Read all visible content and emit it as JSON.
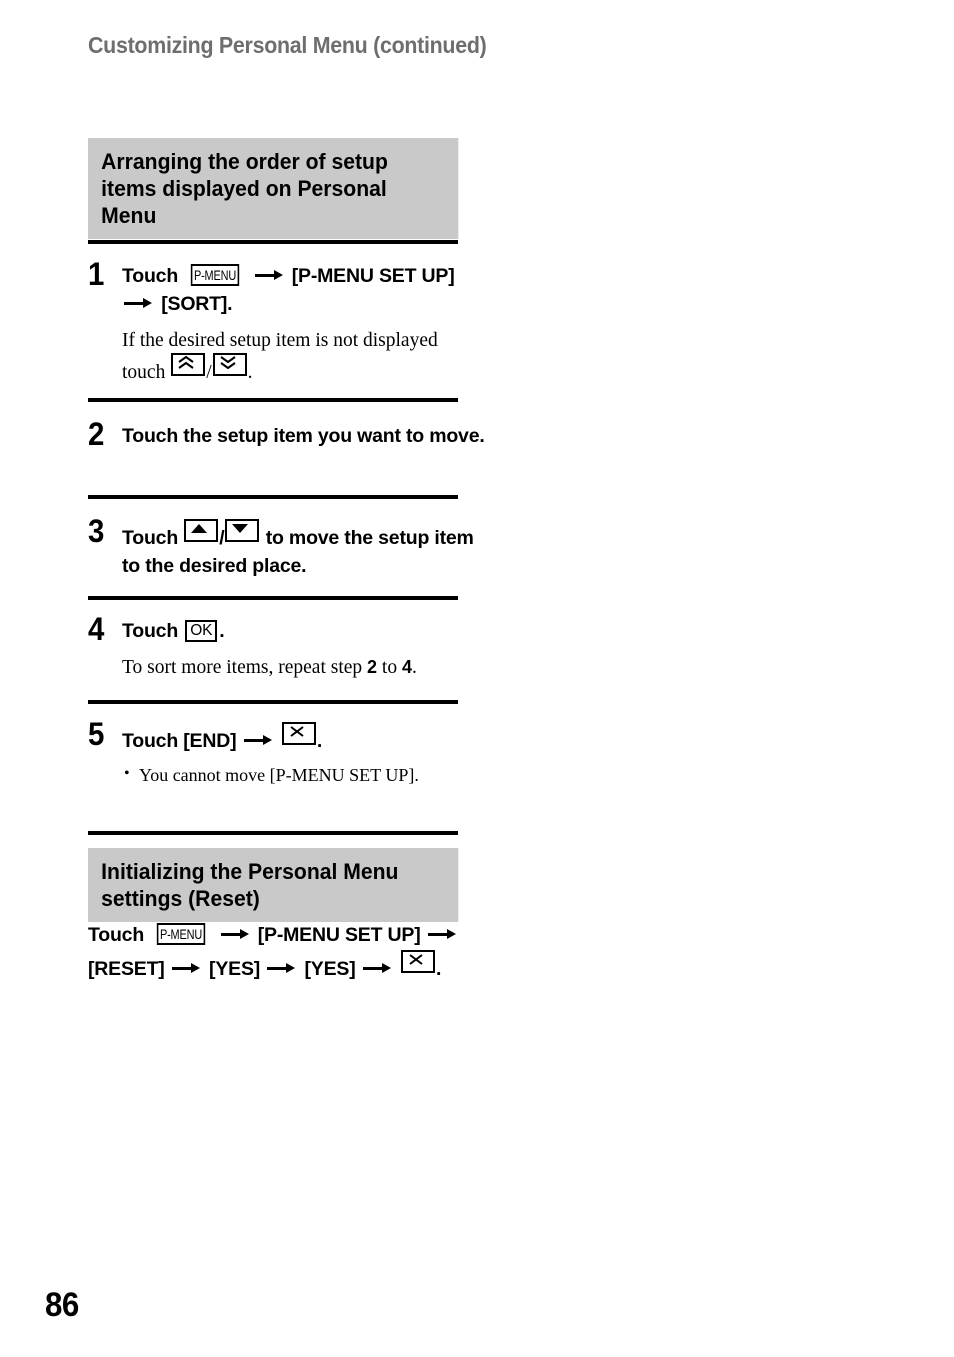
{
  "page": {
    "running_header": "Customizing Personal Menu (continued)",
    "page_number": "86",
    "heading_bg_color": "#c9c9c9",
    "header_text_color": "#6e6e6e"
  },
  "section1": {
    "heading": "Arranging the order of setup items displayed on Personal Menu",
    "steps": [
      {
        "number": "1",
        "title_parts": {
          "touch": "Touch",
          "key_pmenu": "P-MENU",
          "bracket1": "[P-MENU SET UP]",
          "bracket2": "[SORT].",
          "arrow": "⟶"
        },
        "body_parts": {
          "line1": "If the desired setup item is not displayed",
          "touch": "touch",
          "key_up": "double-chevron-up",
          "slash": "/",
          "key_down": "double-chevron-down",
          "period": "."
        }
      },
      {
        "number": "2",
        "title": "Touch the setup item you want to move."
      },
      {
        "number": "3",
        "title_parts": {
          "touch": "Touch",
          "key_up": "triangle-up",
          "slash": "/",
          "key_down": "triangle-down",
          "tail": "to move the setup item to the desired place."
        }
      },
      {
        "number": "4",
        "title_parts": {
          "touch": "Touch",
          "key_ok": "OK",
          "period": "."
        },
        "body_parts": {
          "pre": "To sort more items, repeat step",
          "step_a": "2",
          "mid": "to",
          "step_b": "4",
          "period": "."
        }
      },
      {
        "number": "5",
        "title_parts": {
          "touch": "Touch [END]",
          "arrow": "⟶",
          "key_close": "X",
          "period": "."
        },
        "notes": [
          "You cannot move [P-MENU SET UP]."
        ]
      }
    ]
  },
  "section2": {
    "heading": "Initializing the Personal Menu settings (Reset)",
    "instruction_parts": {
      "touch": "Touch",
      "key_pmenu": "P-MENU",
      "arrow": "⟶",
      "bracket1": "[P-MENU SET UP]",
      "bracket2": "[RESET]",
      "bracket3": "[YES]",
      "bracket4": "[YES]",
      "key_close": "X",
      "period": "."
    }
  }
}
